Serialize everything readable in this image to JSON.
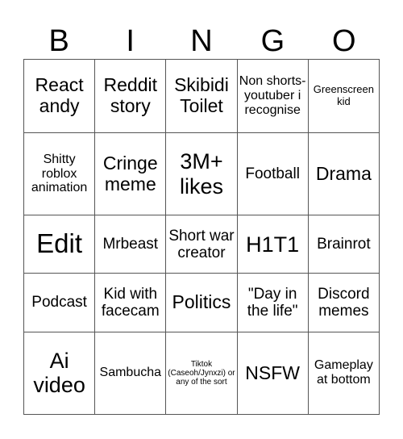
{
  "header": [
    "B",
    "I",
    "N",
    "G",
    "O"
  ],
  "rows": [
    [
      "React andy",
      "Reddit story",
      "Skibidi Toilet",
      "Non shorts-youtuber i recognise",
      "Greenscreen kid"
    ],
    [
      "Shitty roblox animation",
      "Cringe meme",
      "3M+ likes",
      "Football",
      "Drama"
    ],
    [
      "Edit",
      "Mrbeast",
      "Short war creator",
      "H1T1",
      "Brainrot"
    ],
    [
      "Podcast",
      "Kid with facecam",
      "Politics",
      "\"Day in the life\"",
      "Discord memes"
    ],
    [
      "Ai video",
      "Sambucha",
      "Tiktok (Caseoh/Jynxzi) or any of the sort",
      "NSFW",
      "Gameplay at bottom"
    ]
  ]
}
